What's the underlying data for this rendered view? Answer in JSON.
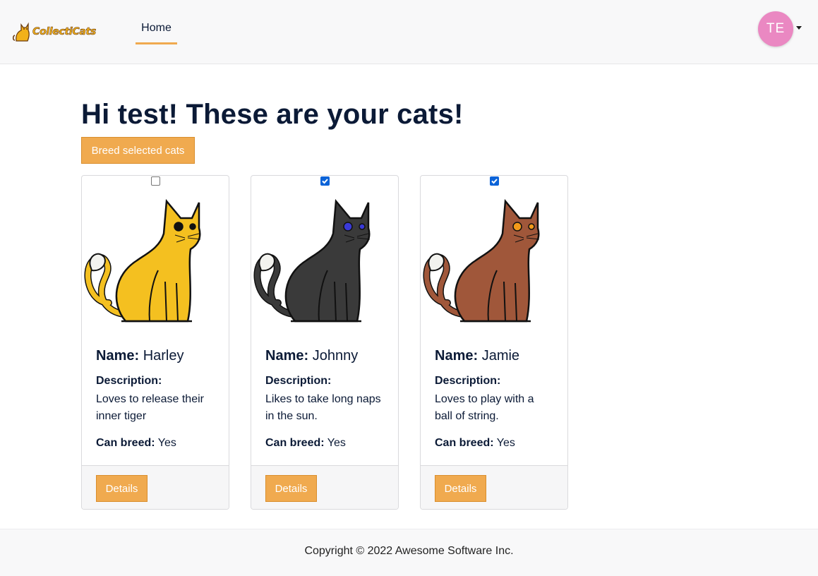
{
  "brand": {
    "name": "CollectiCats",
    "logo_icon": "cat-logo-icon"
  },
  "nav": {
    "home_label": "Home"
  },
  "user": {
    "initials": "TE",
    "avatar_color": "#ea88c2"
  },
  "page": {
    "title": "Hi test! These are your cats!",
    "breed_button_label": "Breed selected cats"
  },
  "labels": {
    "name": "Name:",
    "description": "Description:",
    "can_breed": "Can breed:",
    "details": "Details"
  },
  "cats": [
    {
      "name": "Harley",
      "description": "Loves to release their inner tiger",
      "can_breed": "Yes",
      "selected": false,
      "coat_color": "#f4c020",
      "eye_color": "#111111"
    },
    {
      "name": "Johnny",
      "description": "Likes to take long naps in the sun.",
      "can_breed": "Yes",
      "selected": true,
      "coat_color": "#3a3a3a",
      "eye_color": "#3a3ad8"
    },
    {
      "name": "Jamie",
      "description": "Loves to play with a ball of string.",
      "can_breed": "Yes",
      "selected": true,
      "coat_color": "#a0573a",
      "eye_color": "#f29a1a"
    }
  ],
  "colors": {
    "accent": "#f0aa4f",
    "text": "#0b1a36",
    "checkbox_checked": "#0b63d8"
  },
  "footer": {
    "copyright": "Copyright © 2022 Awesome Software Inc."
  }
}
